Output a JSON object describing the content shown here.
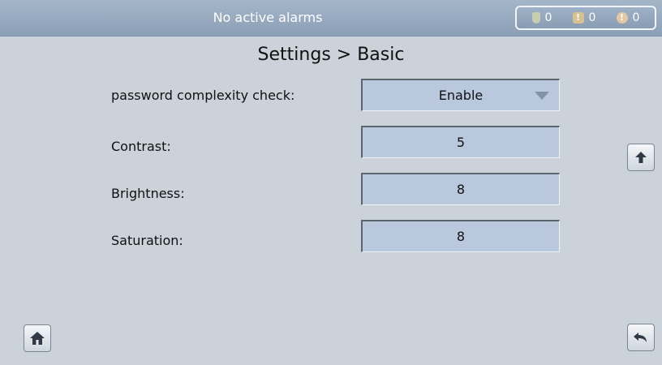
{
  "header": {
    "status_text": "No active alarms",
    "alarms": [
      {
        "icon": "minor-alarm-icon",
        "count": "0",
        "color": "#c9cdb0"
      },
      {
        "icon": "major-alarm-icon",
        "count": "0",
        "color": "#d8c090"
      },
      {
        "icon": "critical-alarm-icon",
        "count": "0",
        "color": "#e2c7a3"
      }
    ]
  },
  "page": {
    "title": "Settings > Basic"
  },
  "settings": [
    {
      "label": "password complexity check:",
      "value": "Enable",
      "type": "dropdown"
    },
    {
      "label": "Contrast:",
      "value": "5",
      "type": "input"
    },
    {
      "label": "Brightness:",
      "value": "8",
      "type": "input"
    },
    {
      "label": "Saturation:",
      "value": "8",
      "type": "input"
    }
  ],
  "nav": {
    "scroll_up_icon": "up-arrow-icon",
    "home_icon": "home-icon",
    "back_icon": "back-icon"
  },
  "colors": {
    "background": "#cbd2da",
    "header": "#8b9fb6",
    "field": "#b9c8dc"
  }
}
